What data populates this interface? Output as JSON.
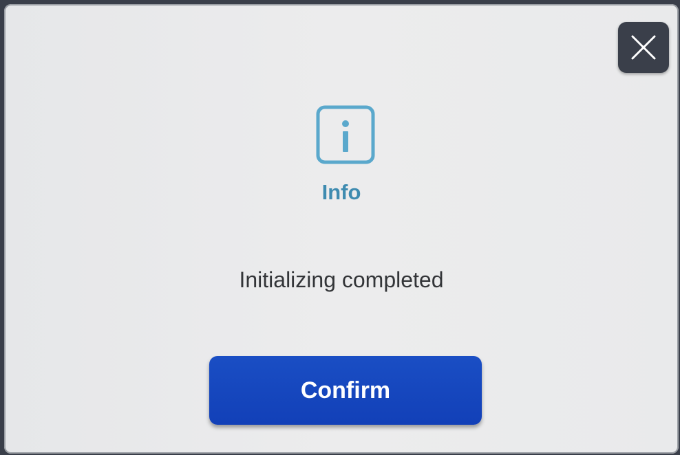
{
  "dialog": {
    "title": "Info",
    "message": "Initializing completed",
    "confirm_label": "Confirm",
    "close_icon": "close-icon",
    "info_icon": "info-icon"
  },
  "colors": {
    "accent": "#3e8bb0",
    "button": "#1a4ec4",
    "close_bg": "#3a3f4a",
    "dialog_bg": "#e9eaeb",
    "text": "#333538"
  }
}
